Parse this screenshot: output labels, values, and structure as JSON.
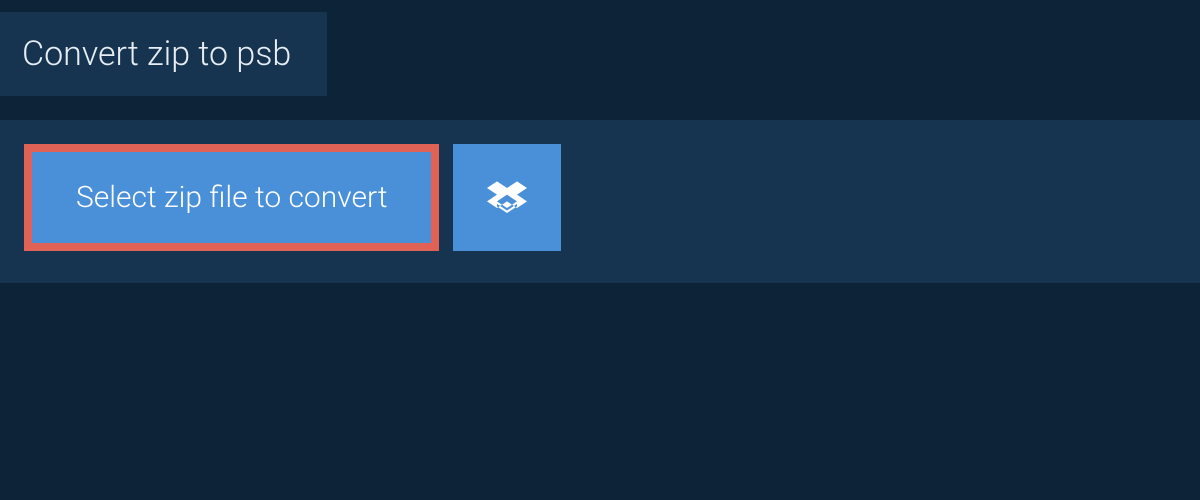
{
  "header": {
    "title": "Convert zip to psb"
  },
  "main": {
    "select_button_label": "Select zip file to convert"
  },
  "colors": {
    "background_dark": "#0d2438",
    "panel": "#163450",
    "button_primary": "#4a90d9",
    "button_highlight_border": "#e06257",
    "text": "#e6edf3"
  }
}
